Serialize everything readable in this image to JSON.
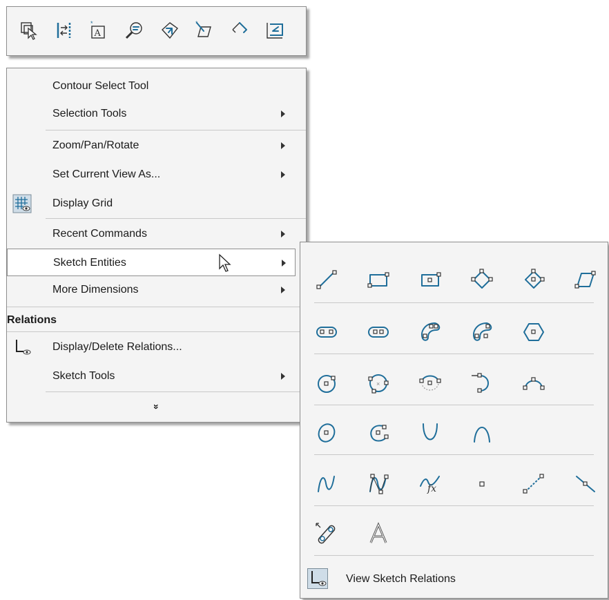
{
  "toolbar": {
    "icons": [
      "select-icon",
      "smart-dimension-icon",
      "note-icon",
      "zoom-to-selection-icon",
      "view-orientation-icon",
      "normal-to-icon",
      "previous-view-icon",
      "exit-sketch-icon"
    ]
  },
  "menu": {
    "contour_select": "Contour Select Tool",
    "selection_tools": "Selection Tools",
    "zoom_pan_rotate": "Zoom/Pan/Rotate",
    "set_current_view": "Set Current View As...",
    "display_grid": "Display Grid",
    "recent_commands": "Recent Commands",
    "sketch_entities": "Sketch Entities",
    "more_dimensions": "More Dimensions",
    "relations_heading": "Relations",
    "display_delete_relations": "Display/Delete Relations...",
    "sketch_tools": "Sketch Tools",
    "expand_glyph": "»"
  },
  "submenu": {
    "view_sketch_relations": "View Sketch Relations",
    "rows": [
      [
        "line-icon",
        "corner-rectangle-icon",
        "center-rectangle-icon",
        "3-point-corner-rectangle-icon",
        "3-point-center-rectangle-icon",
        "parallelogram-icon"
      ],
      [
        "straight-slot-icon",
        "centerpoint-straight-slot-icon",
        "3-point-arc-slot-icon",
        "centerpoint-arc-slot-icon",
        "polygon-icon"
      ],
      [
        "circle-icon",
        "perimeter-circle-icon",
        "centerpoint-arc-icon",
        "tangent-arc-icon",
        "3-point-arc-icon"
      ],
      [
        "ellipse-icon",
        "partial-ellipse-icon",
        "parabola-icon",
        "conic-icon"
      ],
      [
        "spline-icon",
        "style-spline-icon",
        "equation-driven-curve-icon",
        "point-icon",
        "centerline-icon",
        "midpoint-line-icon"
      ],
      [
        "sketch-picture-icon",
        "text-icon"
      ]
    ]
  },
  "colors": {
    "accent": "#1f6e9a",
    "panel": "#f4f4f4",
    "border": "#8c8c8c"
  }
}
